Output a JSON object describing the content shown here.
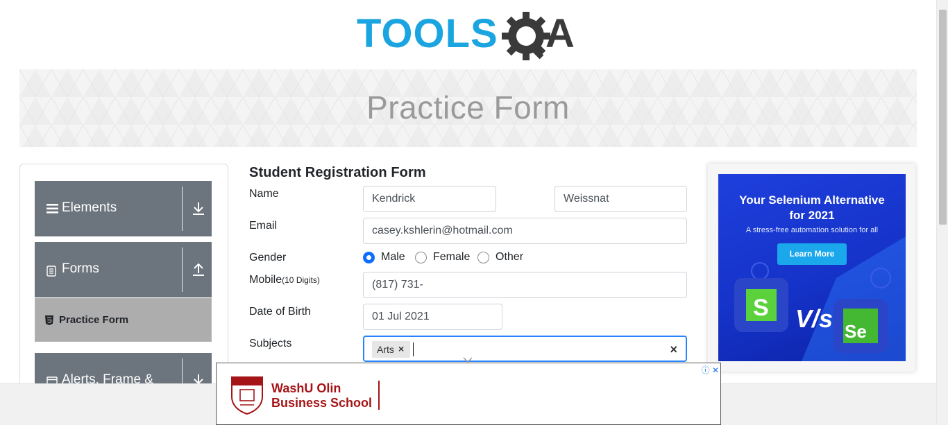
{
  "header": {
    "logo_text_left": "TOOLS",
    "logo_text_right": "QA",
    "page_title": "Practice Form"
  },
  "sidebar": {
    "groups": [
      {
        "label": "Elements",
        "icon": "hamburger-icon",
        "state": "collapsed"
      },
      {
        "label": "Forms",
        "icon": "document-icon",
        "state": "expanded"
      },
      {
        "label": "Alerts, Frame &",
        "icon": "window-icon",
        "state": "collapsed"
      }
    ],
    "active_item": {
      "label": "Practice Form",
      "icon": "html5-icon"
    }
  },
  "form": {
    "title": "Student Registration Form",
    "name_label": "Name",
    "first_name": "Kendrick",
    "last_name": "Weissnat",
    "email_label": "Email",
    "email": "casey.kshlerin@hotmail.com",
    "gender_label": "Gender",
    "gender_options": [
      "Male",
      "Female",
      "Other"
    ],
    "gender_selected": "Male",
    "mobile_label": "Mobile",
    "mobile_hint": "(10 Digits)",
    "mobile": "(817) 731-",
    "dob_label": "Date of Birth",
    "dob": "01 Jul 2021",
    "subjects_label": "Subjects",
    "subjects_chip": "Arts",
    "subjects_chip_remove": "×",
    "subjects_clear": "×"
  },
  "right_ad": {
    "headline_1": "Your Selenium Alternative",
    "headline_2": "for 2021",
    "subtext": "A stress-free automation solution for all",
    "button": "Learn More",
    "vs_text": "V/s",
    "left_logo": "S",
    "right_logo": "Se"
  },
  "bottom_ad": {
    "line1": "WashU Olin",
    "line2": "Business School",
    "adchoices": "ⓘ ✕"
  },
  "colors": {
    "brand_blue": "#1aa4e0",
    "sidebar_header": "#6c757d",
    "sidebar_active": "#adadad",
    "focus_border": "#2684ff",
    "radio_checked": "#0d6efd",
    "ad_red": "#a51417"
  }
}
